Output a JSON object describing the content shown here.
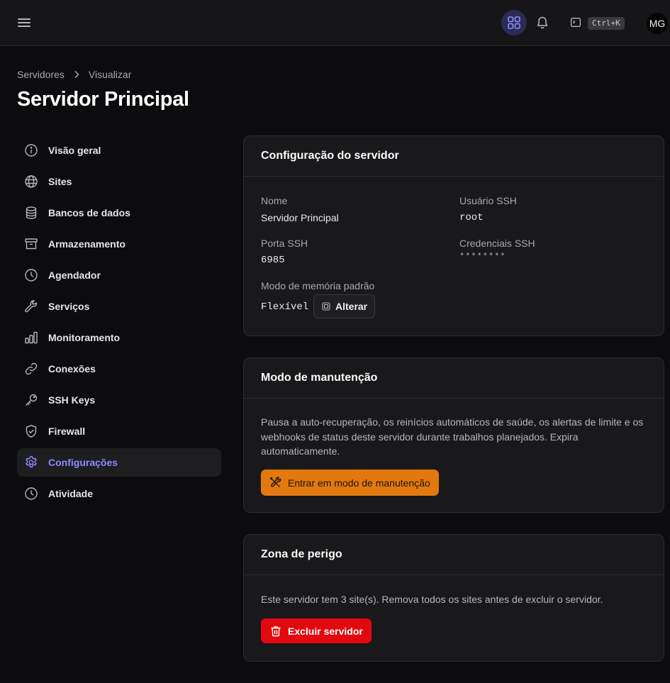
{
  "topbar": {
    "menu_icon": "menu-icon",
    "apps_icon": "grid-icon",
    "notifications_icon": "bell-icon",
    "terminal_icon": "terminal-icon",
    "shortcut": "Ctrl+K",
    "avatar_initials": "MG",
    "accent_color": "#2b2b55"
  },
  "breadcrumb": {
    "root": "Servidores",
    "current": "Visualizar"
  },
  "page_title": "Servidor Principal",
  "sidebar": {
    "active_color": "#8b8bff",
    "items": [
      {
        "label": "Visão geral",
        "icon": "info-icon"
      },
      {
        "label": "Sites",
        "icon": "globe-icon"
      },
      {
        "label": "Bancos de dados",
        "icon": "database-icon"
      },
      {
        "label": "Armazenamento",
        "icon": "archive-icon"
      },
      {
        "label": "Agendador",
        "icon": "clock-icon"
      },
      {
        "label": "Serviços",
        "icon": "wrench-icon"
      },
      {
        "label": "Monitoramento",
        "icon": "bar-chart-icon"
      },
      {
        "label": "Conexões",
        "icon": "link-icon"
      },
      {
        "label": "SSH Keys",
        "icon": "key-icon"
      },
      {
        "label": "Firewall",
        "icon": "shield-icon"
      },
      {
        "label": "Configurações",
        "icon": "gear-icon",
        "active": true
      },
      {
        "label": "Atividade",
        "icon": "clock-icon"
      }
    ]
  },
  "server_config": {
    "title": "Configuração do servidor",
    "name_label": "Nome",
    "name_value": "Servidor Principal",
    "ssh_user_label": "Usuário SSH",
    "ssh_user_value": "root",
    "ssh_port_label": "Porta SSH",
    "ssh_port_value": "6985",
    "ssh_credentials_label": "Credenciais SSH",
    "ssh_credentials_value": "********",
    "memory_mode_label": "Modo de memória padrão",
    "memory_mode_value": "Flexível",
    "change_button": "Alterar"
  },
  "maintenance": {
    "title": "Modo de manutenção",
    "description": "Pausa a auto-recuperação, os reinícios automáticos de saúde, os alertas de limite e os webhooks de status deste servidor durante trabalhos planejados. Expira automaticamente.",
    "button": "Entrar em modo de manutenção",
    "button_color": "#e2790f"
  },
  "danger_zone": {
    "title": "Zona de perigo",
    "description": "Este servidor tem 3 site(s). Remova todos os sites antes de excluir o servidor.",
    "button": "Excluir servidor",
    "button_color": "#e20a10"
  }
}
